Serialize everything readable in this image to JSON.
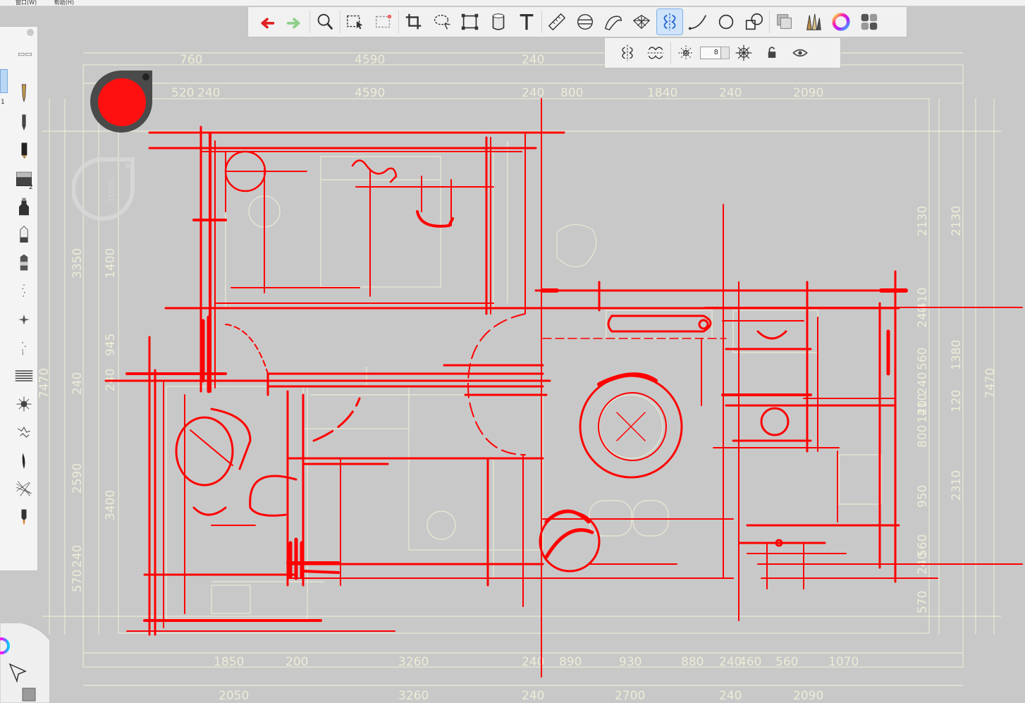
{
  "app": {
    "menu_items": [
      "窗口(W)",
      "帮助(H)"
    ]
  },
  "toolbar": {
    "tools": [
      {
        "id": "undo",
        "icon": "undo-arrow-icon",
        "active": false
      },
      {
        "id": "redo",
        "icon": "redo-arrow-icon",
        "active": false
      },
      {
        "id": "zoom",
        "icon": "magnifier-icon",
        "active": false
      },
      {
        "id": "select",
        "icon": "selection-icon",
        "active": false
      },
      {
        "id": "select-delete",
        "icon": "selection-clear-icon",
        "active": false
      },
      {
        "id": "crop",
        "icon": "crop-icon",
        "active": false
      },
      {
        "id": "lasso",
        "icon": "lasso-icon",
        "active": false
      },
      {
        "id": "transform",
        "icon": "transform-icon",
        "active": false
      },
      {
        "id": "fill",
        "icon": "fill-bucket-icon",
        "active": false
      },
      {
        "id": "text",
        "icon": "text-icon",
        "active": false
      },
      {
        "id": "ruler",
        "icon": "ruler-icon",
        "active": false
      },
      {
        "id": "ellipse-guide",
        "icon": "ellipse-guide-icon",
        "active": false
      },
      {
        "id": "french-curve",
        "icon": "french-curve-icon",
        "active": false
      },
      {
        "id": "perspective",
        "icon": "perspective-grid-icon",
        "active": false
      },
      {
        "id": "symmetry",
        "icon": "symmetry-icon",
        "active": true
      },
      {
        "id": "stroke",
        "icon": "steady-stroke-icon",
        "active": false
      },
      {
        "id": "shape",
        "icon": "circle-shape-icon",
        "active": false
      },
      {
        "id": "shapes",
        "icon": "shapes-icon",
        "active": false
      },
      {
        "id": "layers",
        "icon": "layers-icon",
        "active": false
      },
      {
        "id": "brushes",
        "icon": "brush-library-icon",
        "active": false
      },
      {
        "id": "color",
        "icon": "color-wheel-icon",
        "active": false
      },
      {
        "id": "palette",
        "icon": "swatch-grid-icon",
        "active": false
      }
    ],
    "sub_tools": {
      "modes": [
        "symmetry-y-icon",
        "symmetry-wave-icon",
        "radial-symmetry-icon"
      ],
      "axis_count": "8",
      "extra": [
        "radial-center-icon",
        "lock-icon",
        "eye-icon"
      ]
    }
  },
  "color_puck": {
    "color": "#ff1010"
  },
  "size_puck": {
    "label": "100%"
  },
  "left_panel": {
    "numbers": [
      "1",
      "2"
    ],
    "brushes": [
      "ballpoint-pen-icon",
      "pencil-icon",
      "marker-icon",
      "eraser-icon",
      "airbrush-icon",
      "spray-nozzle-icon",
      "chisel-marker-icon",
      "dot-brush-icon",
      "star-brush-icon",
      "scatter-brush-icon",
      "hatch-brush-icon",
      "splatter-brush-icon",
      "crackle-brush-icon",
      "ink-stroke-icon",
      "texture-brush-icon",
      "smudge-brush-icon"
    ]
  },
  "drawing": {
    "accent": "#ff0000",
    "plan_color": "#f0efd8",
    "dims_top_outer": [
      "760",
      "4590",
      "240"
    ],
    "dims_top_inner": [
      "520",
      "240",
      "4590",
      "240",
      "800",
      "1840",
      "240",
      "2090"
    ],
    "dims_bottom_inner": [
      "1850",
      "200",
      "3260",
      "240",
      "890",
      "930",
      "880",
      "240",
      "460",
      "560",
      "1070"
    ],
    "dims_bottom_outer": [
      "2050",
      "3260",
      "240",
      "2700",
      "240",
      "2090"
    ],
    "dims_left_a": [
      "3350",
      "240",
      "2590",
      "570",
      "240"
    ],
    "dims_left_b": [
      "1400",
      "945",
      "240",
      "3400"
    ],
    "dims_left_total": "7470",
    "dims_right_a": [
      "2130",
      "410",
      "240",
      "560",
      "240",
      "410",
      "120",
      "800",
      "950",
      "560",
      "240",
      "570"
    ],
    "dims_right_b": [
      "2130",
      "1380",
      "120",
      "2310"
    ],
    "dims_right_total": "7470"
  }
}
